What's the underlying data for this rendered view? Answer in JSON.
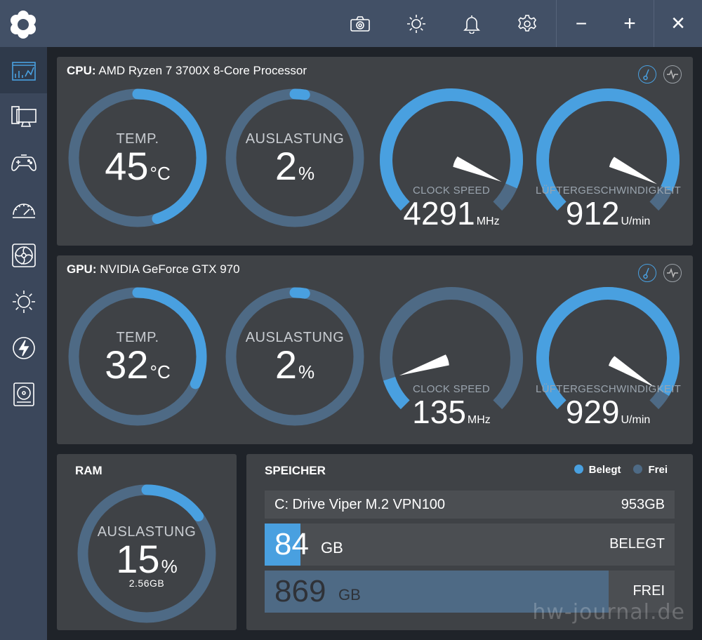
{
  "colors": {
    "accent": "#49a0e0",
    "track": "#4e6a85",
    "panel": "#3f4246",
    "titlebar": "#425066"
  },
  "titlebar": {
    "icons": [
      "camera-icon",
      "brightness-icon",
      "bell-icon",
      "gear-icon"
    ],
    "minimize": "−",
    "maximize": "+",
    "close": "×"
  },
  "sidebar": {
    "items": [
      "dashboard-icon",
      "monitor-icon",
      "gamepad-icon",
      "speedometer-icon",
      "fan-icon",
      "brightness-icon",
      "power-icon",
      "drive-icon"
    ]
  },
  "cpu": {
    "prefix": "CPU:",
    "name": "AMD Ryzen 7 3700X 8-Core Processor",
    "temp": {
      "label": "TEMP.",
      "value": "45",
      "unit": "°C",
      "level": 0.45
    },
    "load": {
      "label": "AUSLASTUNG",
      "value": "2",
      "unit": "%",
      "level": 0.02
    },
    "clock": {
      "label": "CLOCK SPEED",
      "value": "4291",
      "unit": "MHz",
      "level": 0.92
    },
    "fan": {
      "label": "LÜFTERGESCHWINDIGKEIT",
      "value": "912",
      "unit": "U/min",
      "level": 0.93
    }
  },
  "gpu": {
    "prefix": "GPU:",
    "name": "NVIDIA GeForce GTX 970",
    "temp": {
      "label": "TEMP.",
      "value": "32",
      "unit": "°C",
      "level": 0.32
    },
    "load": {
      "label": "AUSLASTUNG",
      "value": "2",
      "unit": "%",
      "level": 0.02
    },
    "clock": {
      "label": "CLOCK SPEED",
      "value": "135",
      "unit": "MHz",
      "level": 0.1
    },
    "fan": {
      "label": "LÜFTERGESCHWINDIGKEIT",
      "value": "929",
      "unit": "U/min",
      "level": 0.95
    }
  },
  "ram": {
    "title": "RAM",
    "label": "AUSLASTUNG",
    "value": "15",
    "unit": "%",
    "sub": "2.56GB",
    "level": 0.15
  },
  "storage": {
    "title": "SPEICHER",
    "legend_used": "Belegt",
    "legend_free": "Frei",
    "drive_name": "C: Drive Viper M.2 VPN100",
    "drive_size": "953GB",
    "used_value": "84",
    "used_unit": "GB",
    "used_label": "BELEGT",
    "free_value": "869",
    "free_unit": "GB",
    "free_label": "FREI",
    "used_fraction": 0.088
  },
  "watermark": "hw-journal.de"
}
